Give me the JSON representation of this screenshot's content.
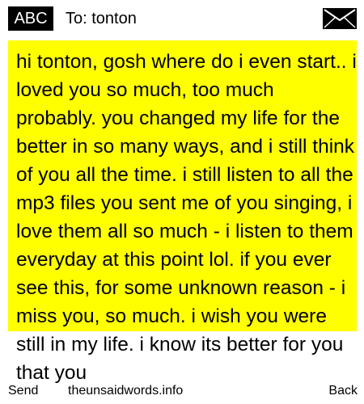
{
  "header": {
    "mode_label": "ABC",
    "recipient": "To: tonton",
    "envelope_icon": "envelope-icon"
  },
  "message": {
    "body": "hi tonton, gosh where do i even start.. i loved you so much, too much probably. you changed my life for the better in so many ways, and i still think of you all the time. i still listen to all the mp3 files you sent me of you singing, i love them all so much - i listen to them everyday at this point lol. if you ever see this, for some unknown reason - i miss you, so much. i wish you were still in my life. i know its better for you that you",
    "highlight_color": "#ffff00"
  },
  "softkeys": {
    "left_label": "Send",
    "center_label": "theunsaidwords.info",
    "right_label": "Back"
  }
}
